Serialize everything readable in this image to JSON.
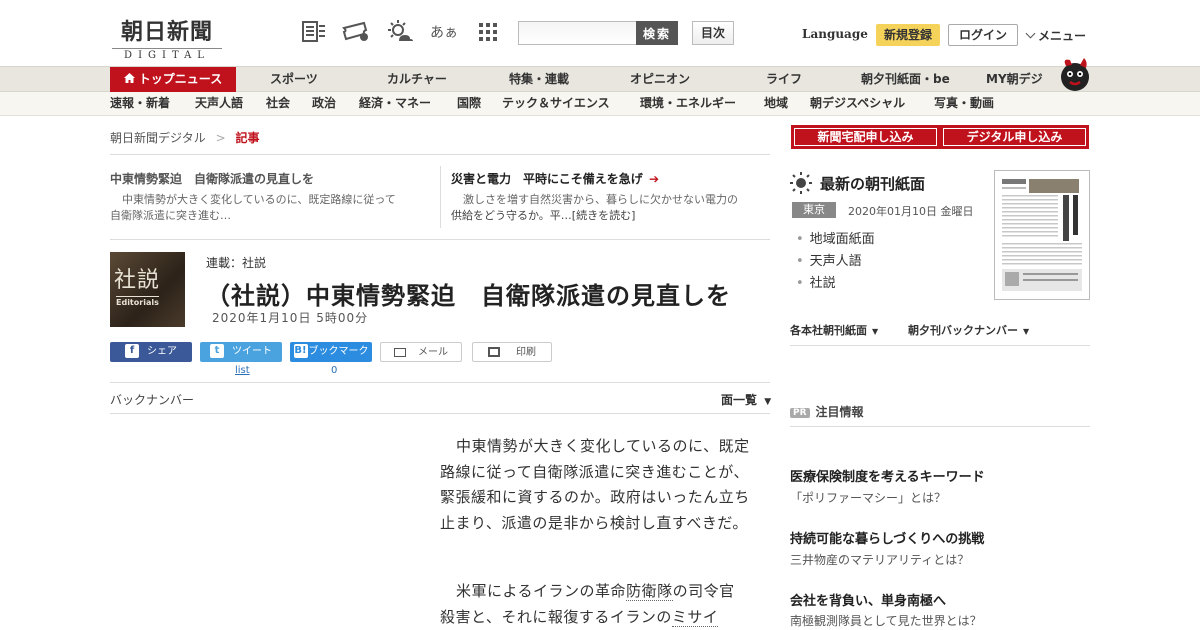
{
  "header": {
    "logo_main": "朝日新聞",
    "logo_sub": "DIGITAL",
    "search_placeholder": "",
    "search_button": "検索",
    "index_button": "目次",
    "language": "Language",
    "register": "新規登録",
    "login": "ログイン",
    "menu": "メニュー",
    "font_icon_text": "あぁ"
  },
  "nav": {
    "items": [
      "トップニュース",
      "スポーツ",
      "カルチャー",
      "特集・連載",
      "オピニオン",
      "ライフ",
      "朝夕刊紙面・be",
      "MY朝デジ"
    ]
  },
  "subnav": {
    "items": [
      "速報・新着",
      "天声人語",
      "社会",
      "政治",
      "経済・マネー",
      "国際",
      "テック＆サイエンス",
      "環境・エネルギー",
      "地域",
      "朝デジスペシャル",
      "写真・動画"
    ]
  },
  "breadcrumb": {
    "root": "朝日新聞デジタル",
    "sep": ">",
    "current": "記事"
  },
  "related": [
    {
      "title": "中東情勢緊迫　自衛隊派遣の見直しを",
      "text1": "中東情勢が大きく変化しているのに、既定路線に従って",
      "text2": "自衛隊派遣に突き進む…"
    },
    {
      "title": "災害と電力　平時にこそ備えを急げ",
      "arrow": "➔",
      "text1": "激しさを増す自然災害から、暮らしに欠かせない電力の",
      "text2": "供給をどう守るか。平…[続きを読む]"
    }
  ],
  "article": {
    "image_big": "社説",
    "image_en": "Editorials",
    "series": "連載：社説",
    "headline": "（社説）中東情勢緊迫　自衛隊派遣の見直しを",
    "date": "2020年1月10日 5時00分"
  },
  "share": {
    "facebook": "シェア",
    "twitter": "ツイート",
    "hatena": "ブックマーク",
    "mail": "メール",
    "print": "印刷",
    "twitter_count": "list",
    "hatena_count": "0"
  },
  "backnumber": {
    "label": "バックナンバー",
    "list": "面一覧"
  },
  "body": {
    "p1": "中東情勢が大きく変化しているのに、既定路線に従って自衛隊派遣に突き進むことが、緊張緩和に資するのか。政府はいったん立ち止まり、派遣の是非から検討し直すべきだ。",
    "p2a": "米軍によるイランの革命",
    "p2link1": "防衛隊",
    "p2b": "の司令官殺害と、それに報復するイランの",
    "p2link2": "ミサイ"
  },
  "sidebar": {
    "subscribe_paper": "新聞宅配申し込み",
    "subscribe_digital": "デジタル申し込み",
    "paper_title": "最新の朝刊紙面",
    "region": "東京",
    "paper_date": "2020年01月10日 金曜日",
    "paper_links": [
      "地域面紙面",
      "天声人語",
      "社説"
    ],
    "drop1": "各本社朝刊紙面",
    "drop2": "朝夕刊バックナンバー",
    "pr_tag": "PR",
    "pr_label": "注目情報",
    "ads": [
      {
        "title": "医療保険制度を考えるキーワード",
        "sub": "「ポリファーマシー」とは？"
      },
      {
        "title": "持続可能な暮らしづくりへの挑戦",
        "sub": "三井物産のマテリアリティとは？"
      },
      {
        "title": "会社を背負い、単身南極へ",
        "sub": "南極観測隊員として見た世界とは？"
      }
    ]
  },
  "colors": {
    "brand_red": "#c0121c",
    "nav_bg": "#e8e6df",
    "register_yellow": "#f5d35b"
  }
}
